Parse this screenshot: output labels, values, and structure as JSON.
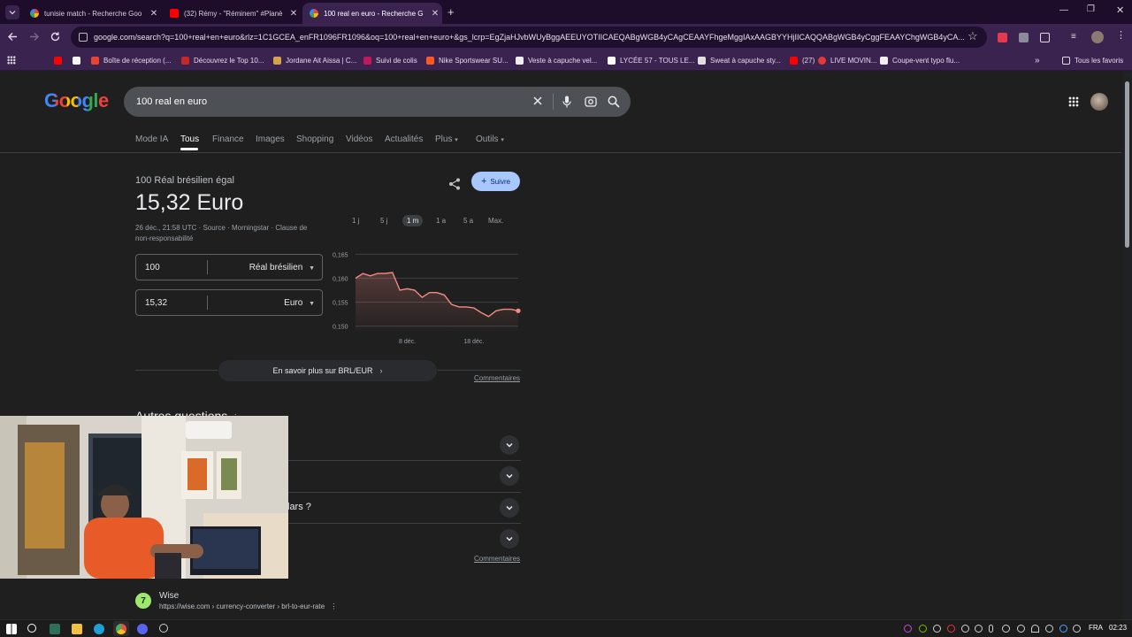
{
  "browser": {
    "tabs": [
      {
        "title": "tunisie match - Recherche Goo",
        "favicon": "google-icon"
      },
      {
        "title": "(32) Rémy - \"Réminem\" #Planè",
        "favicon": "youtube-icon"
      },
      {
        "title": "100 real en euro - Recherche G",
        "favicon": "google-icon"
      }
    ],
    "url": "google.com/search?q=100+real+en+euro&rlz=1C1GCEA_enFR1096FR1096&oq=100+real+en+euro+&gs_lcrp=EgZjaHJvbWUyBggAEEUYOTIICAEQABgWGB4yCAgCEAAYFhgeMggIAxAAGBYYHjIICAQQABgWGB4yCggFEAAYChgWGB4yCA...",
    "bookmarks": [
      "Boîte de réception (...",
      "Découvrez le Top 10...",
      "Jordane Ait Aissa | C...",
      "Suivi de colis",
      "Nike Sportswear SU...",
      "Veste à capuche vel...",
      "LYCÉE 57 - TOUS LE...",
      "Sweat à capuche sty...",
      "(27)",
      "LIVE MOVIN...",
      "Coupe-vent typo flu..."
    ],
    "all_bookmarks_label": "Tous les favoris"
  },
  "google": {
    "logo": "Google",
    "query": "100 real en euro",
    "nav_tabs": [
      "Mode IA",
      "Tous",
      "Finance",
      "Images",
      "Shopping",
      "Vidéos",
      "Actualités",
      "Plus",
      "Outils"
    ],
    "active_tab": "Tous"
  },
  "converter": {
    "subtitle": "100 Réal brésilien égal",
    "result": "15,32 Euro",
    "meta_date": "26 déc., 21:58 UTC",
    "meta_source": "Source",
    "meta_provider": "Morningstar",
    "meta_disclaimer_1": "Clause de",
    "meta_disclaimer_2": "non-responsabilité",
    "follow_label": "Suivre",
    "from_amount": "100",
    "from_currency": "Réal brésilien",
    "to_amount": "15,32",
    "to_currency": "Euro",
    "ranges": [
      "1 j",
      "5 j",
      "1 m",
      "1 a",
      "5 a",
      "Max."
    ],
    "selected_range": "1 m",
    "more_label": "En savoir plus sur BRL/EUR",
    "feedback_label": "Commentaires"
  },
  "chart_data": {
    "type": "area",
    "yticks": [
      "0,165",
      "0,160",
      "0,155",
      "0,150"
    ],
    "ylim": [
      0.149,
      0.166
    ],
    "xticks": [
      "8 déc.",
      "18 déc."
    ],
    "values": [
      0.16,
      0.161,
      0.1605,
      0.161,
      0.161,
      0.1612,
      0.1575,
      0.1578,
      0.1575,
      0.156,
      0.157,
      0.157,
      0.1565,
      0.1545,
      0.154,
      0.154,
      0.1538,
      0.1528,
      0.152,
      0.1532,
      0.1535,
      0.1535,
      0.1532
    ],
    "line_color": "#f28b82"
  },
  "people_also_ask": {
    "heading": "Autres questions",
    "visible_fragment": "lars ?",
    "feedback_label": "Commentaires"
  },
  "result": {
    "site_name": "Wise",
    "url": "https://wise.com",
    "path": "› currency-converter › brl-to-eur-rate"
  },
  "taskbar": {
    "language": "FRA",
    "time": "02:23"
  }
}
